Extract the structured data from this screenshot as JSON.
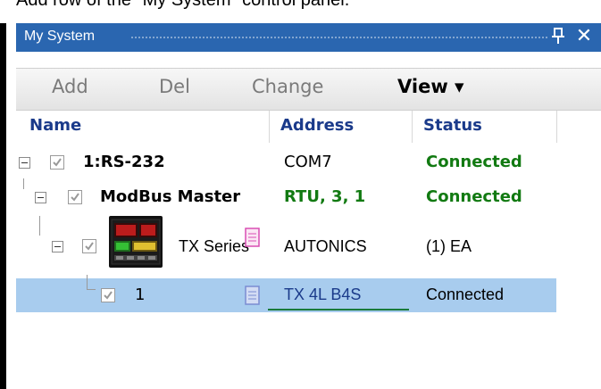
{
  "caption": "Add row of the \"My System\" control panel.",
  "window": {
    "title": "My System"
  },
  "toolbar": {
    "add": "Add",
    "del": "Del",
    "change": "Change",
    "view": "View ▾"
  },
  "columns": {
    "name": "Name",
    "address": "Address",
    "status": "Status"
  },
  "rows": [
    {
      "name": "1:RS-232",
      "address": "COM7",
      "status": "Connected"
    },
    {
      "name": "ModBus Master",
      "address": "RTU, 3, 1",
      "status": "Connected"
    },
    {
      "name": "TX Series",
      "address": "AUTONICS",
      "status": "(1) EA"
    },
    {
      "name": "1",
      "address": "TX 4L B4S",
      "status": "Connected"
    }
  ],
  "colors": {
    "titlebar": "#2a66b0",
    "selected_row": "#a8ccee",
    "connected_green": "#127a12",
    "header_blue": "#1a3a8a"
  }
}
